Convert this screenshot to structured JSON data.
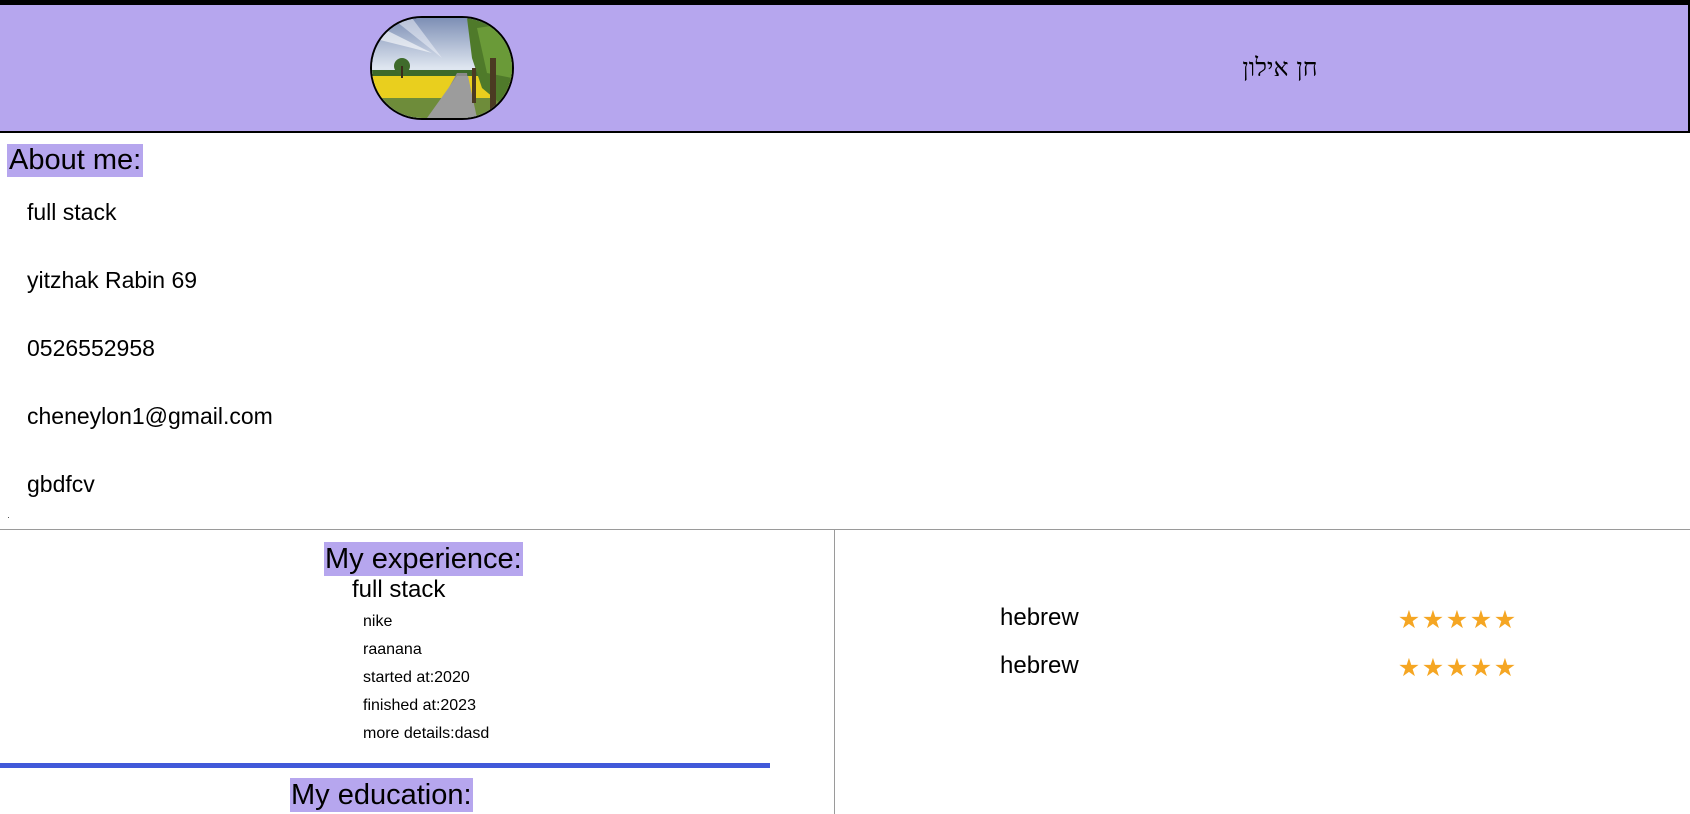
{
  "header": {
    "name": "חן אילון",
    "avatar_icon": "landscape-photo-icon"
  },
  "about": {
    "title": "About me:",
    "lines": [
      "full stack",
      "yitzhak Rabin 69",
      "0526552958",
      "cheneylon1@gmail.com",
      "gbdfcv"
    ]
  },
  "experience": {
    "title": "My experience:",
    "items": [
      {
        "role": "full stack",
        "company": "nike",
        "city": "raanana",
        "started": "started at:2020",
        "finished": "finished at:2023",
        "details": "more details:dasd"
      }
    ]
  },
  "education": {
    "title": "My education:"
  },
  "languages": [
    {
      "name": "hebrew",
      "rating": 5,
      "max": 5
    },
    {
      "name": "hebrew",
      "rating": 5,
      "max": 5
    }
  ],
  "colors": {
    "accent": "#b6a6ee",
    "star": "#f5a623",
    "divider": "#4159d9"
  }
}
